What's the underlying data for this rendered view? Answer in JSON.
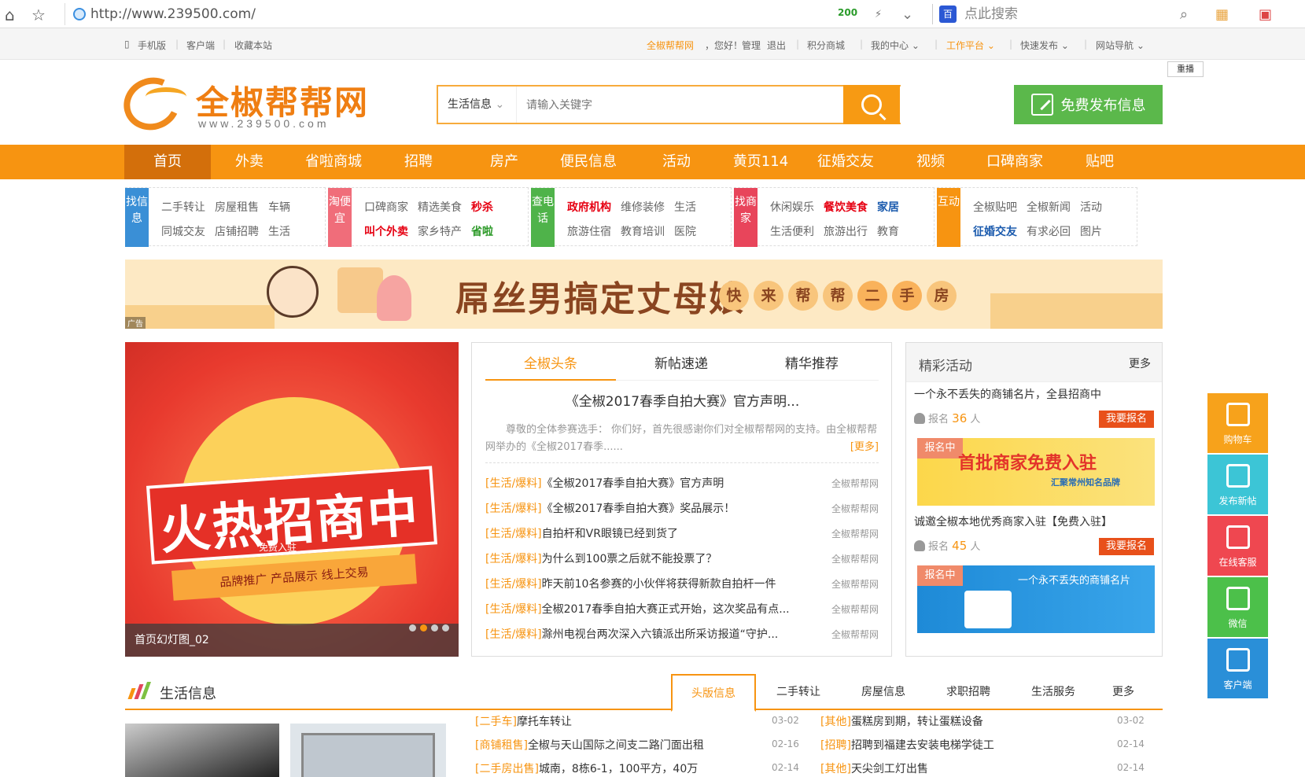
{
  "browser": {
    "url": "http://www.239500.com/",
    "speed": "200",
    "search_placeholder": "点此搜索",
    "baidu": "百"
  },
  "topbar": {
    "mobile": "手机版",
    "client": "客户端",
    "bookmark": "收藏本站",
    "site": "全椒帮帮网",
    "greeting": "，您好！",
    "manage": "管理",
    "logout": "退出",
    "points": "积分商城",
    "mycenter": "我的中心",
    "workbench": "工作平台",
    "quickpost": "快速发布",
    "sitenav": "网站导航"
  },
  "replay": "重播",
  "logo": {
    "name": "全椒帮帮网",
    "url": "www.239500.com"
  },
  "search": {
    "category": "生活信息",
    "placeholder": "请输入关键字"
  },
  "publish": "免费发布信息",
  "mainnav": [
    "首页",
    "外卖",
    "省啦商城",
    "招聘",
    "房产",
    "便民信息",
    "活动",
    "黄页114",
    "征婚交友",
    "视频",
    "口碑商家",
    "贴吧"
  ],
  "cats": [
    {
      "tag": "找信息",
      "color": "#3a8fd6",
      "row1": [
        [
          "二手转让",
          ""
        ],
        [
          "房屋租售",
          ""
        ],
        [
          "车辆",
          ""
        ]
      ],
      "row2": [
        [
          "同城交友",
          ""
        ],
        [
          "店铺招聘",
          ""
        ],
        [
          "生活",
          ""
        ]
      ]
    },
    {
      "tag": "淘便宜",
      "color": "#f06d7a",
      "row1": [
        [
          "口碑商家",
          ""
        ],
        [
          "精选美食",
          ""
        ],
        [
          "秒杀",
          "red"
        ]
      ],
      "row2": [
        [
          "叫个外卖",
          "red"
        ],
        [
          "家乡特产",
          ""
        ],
        [
          "省啦",
          "green"
        ]
      ]
    },
    {
      "tag": "查电话",
      "color": "#4fb34a",
      "row1": [
        [
          "政府机构",
          "red"
        ],
        [
          "维修装修",
          ""
        ],
        [
          "生活",
          ""
        ]
      ],
      "row2": [
        [
          "旅游住宿",
          ""
        ],
        [
          "教育培训",
          ""
        ],
        [
          "医院",
          ""
        ]
      ]
    },
    {
      "tag": "找商家",
      "color": "#e8455b",
      "row1": [
        [
          "休闲娱乐",
          ""
        ],
        [
          "餐饮美食",
          "red"
        ],
        [
          "家居",
          "blue"
        ]
      ],
      "row2": [
        [
          "生活便利",
          ""
        ],
        [
          "旅游出行",
          ""
        ],
        [
          "教育",
          ""
        ]
      ]
    },
    {
      "tag": "互动",
      "color": "#f79411",
      "row1": [
        [
          "全椒贴吧",
          ""
        ],
        [
          "全椒新闻",
          ""
        ],
        [
          "活动",
          ""
        ]
      ],
      "row2": [
        [
          "征婚交友",
          "blue"
        ],
        [
          "有求必回",
          ""
        ],
        [
          "图片",
          ""
        ]
      ]
    }
  ],
  "banner": {
    "headline": "屌丝男搞定丈母娘",
    "chars": [
      "快",
      "来",
      "帮",
      "帮",
      "二",
      "手",
      "房"
    ],
    "ad": "广告"
  },
  "slider": {
    "headline": "火热招商中",
    "sub": "免费入驻",
    "ribbon": "品牌推广   产品展示   线上交易",
    "caption": "首页幻灯图_02"
  },
  "news": {
    "tabs": [
      "全椒头条",
      "新帖速递",
      "精华推荐"
    ],
    "headline": "《全椒2017春季自拍大赛》官方声明...",
    "summary": "尊敬的全体参赛选手： 你们好，首先很感谢你们对全椒帮帮网的支持。由全椒帮帮网举办的《全椒2017春季......",
    "more": "[更多]",
    "items": [
      {
        "cat": "[生活/爆料]",
        "title": "《全椒2017春季自拍大赛》官方声明",
        "src": "全椒帮帮网"
      },
      {
        "cat": "[生活/爆料]",
        "title": "《全椒2017春季自拍大赛》奖品展示！",
        "src": "全椒帮帮网"
      },
      {
        "cat": "[生活/爆料]",
        "title": "自拍杆和VR眼镜已经到货了",
        "src": "全椒帮帮网"
      },
      {
        "cat": "[生活/爆料]",
        "title": "为什么到100票之后就不能投票了？",
        "src": "全椒帮帮网"
      },
      {
        "cat": "[生活/爆料]",
        "title": "昨天前10名参赛的小伙伴将获得新款自拍杆一件",
        "src": "全椒帮帮网"
      },
      {
        "cat": "[生活/爆料]",
        "title": "全椒2017春季自拍大赛正式开始，这次奖品有点...",
        "src": "全椒帮帮网"
      },
      {
        "cat": "[生活/爆料]",
        "title": "滁州电视台两次深入六镇派出所采访报道“守护...",
        "src": "全椒帮帮网"
      }
    ]
  },
  "activities": {
    "title": "精彩活动",
    "more": "更多",
    "item1": {
      "title": "一个永不丢失的商铺名片，全县招商中",
      "label": "报名",
      "count": "36",
      "unit": "人",
      "btn": "我要报名"
    },
    "img1": {
      "badge": "报名中",
      "text": "首批商家免费入驻",
      "sub": "汇聚常州知名品牌"
    },
    "item2": {
      "title": "诚邀全椒本地优秀商家入驻【免费入驻】",
      "label": "报名",
      "count": "45",
      "unit": "人",
      "btn": "我要报名"
    },
    "img2": {
      "badge": "报名中",
      "text": "一个永不丢失的商铺名片"
    }
  },
  "floatbar": [
    {
      "label": "购物车",
      "color": "#f7a21b"
    },
    {
      "label": "发布新帖",
      "color": "#3cc5d6"
    },
    {
      "label": "在线客服",
      "color": "#ef4750"
    },
    {
      "label": "微信",
      "color": "#4cc04a"
    },
    {
      "label": "客户端",
      "color": "#2a8fd8"
    }
  ],
  "life": {
    "title": "生活信息",
    "tabs": [
      "头版信息",
      "二手转让",
      "房屋信息",
      "求职招聘",
      "生活服务",
      "更多"
    ],
    "left": [
      {
        "cat": "[二手车]",
        "title": "摩托车转让",
        "date": "03-02"
      },
      {
        "cat": "[商铺租售]",
        "title": "全椒与天山国际之间支二路门面出租",
        "date": "02-16"
      },
      {
        "cat": "[二手房出售]",
        "title": "城南，8栋6-1，100平方，40万",
        "date": "02-14"
      }
    ],
    "right": [
      {
        "cat": "[其他]",
        "title": "蛋糕房到期，转让蛋糕设备",
        "date": "03-02"
      },
      {
        "cat": "[招聘]",
        "title": "招聘到福建去安装电梯学徒工",
        "date": "02-14"
      },
      {
        "cat": "[其他]",
        "title": "天尖剑工灯出售",
        "date": "02-14"
      }
    ]
  }
}
